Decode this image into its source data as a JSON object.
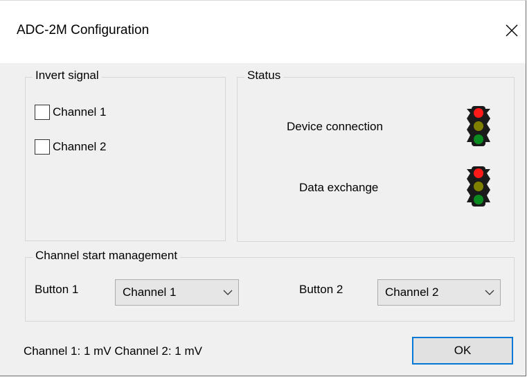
{
  "window": {
    "title": "ADC-2M Configuration"
  },
  "icons": {
    "close": "close-icon",
    "traffic_light": "traffic-light-icon",
    "dropdown": "chevron-down-icon"
  },
  "invert_signal": {
    "legend": "Invert signal",
    "channels": [
      {
        "label": "Channel 1",
        "checked": false
      },
      {
        "label": "Channel 2",
        "checked": false
      }
    ]
  },
  "status": {
    "legend": "Status",
    "items": [
      {
        "label": "Device connection",
        "light": "red"
      },
      {
        "label": "Data exchange",
        "light": "red"
      }
    ],
    "colors": {
      "red_on": "#ff1a1a",
      "yellow_off": "#808000",
      "green_off": "#0b8a1f",
      "body": "#1a1a1a"
    }
  },
  "channel_start": {
    "legend": "Channel start management",
    "button1": {
      "label": "Button 1",
      "selected": "Channel 1"
    },
    "button2": {
      "label": "Button 2",
      "selected": "Channel 2"
    }
  },
  "footer": {
    "status_text": "Channel 1: 1 mV Channel 2: 1 mV",
    "ok_label": "OK",
    "accent_color": "#0078d7"
  }
}
